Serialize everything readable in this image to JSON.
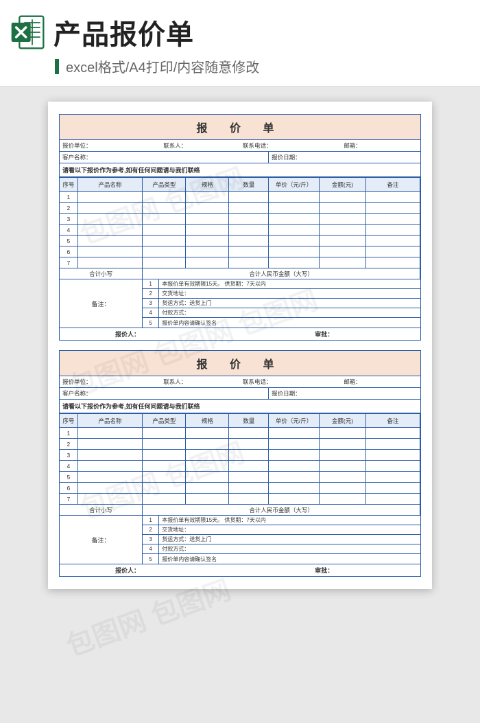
{
  "header": {
    "title": "产品报价单",
    "subtitle": "excel格式/A4打印/内容随意修改"
  },
  "sheet": {
    "title": "报 价 单",
    "info1": {
      "unit_label": "报价单位：",
      "contact_label": "联系人：",
      "phone_label": "联系电话：",
      "email_label": "邮箱："
    },
    "info2": {
      "customer_label": "客户名称：",
      "date_label": "报价日期："
    },
    "note": "请看以下报价作为参考,如有任何问题请与我们联络",
    "columns": {
      "seq": "序号",
      "name": "产品名称",
      "type": "产品类型",
      "spec": "规格",
      "qty": "数量",
      "price": "单价（元/斤）",
      "amount": "金额(元)",
      "remark": "备注"
    },
    "rows": [
      "1",
      "2",
      "3",
      "4",
      "5",
      "6",
      "7"
    ],
    "total": {
      "lower_label": "合计小写",
      "upper_label": "合计人民币金额（大写）"
    },
    "remarks": {
      "label": "备注：",
      "lines": [
        {
          "n": "1",
          "t": "本报价单有效期限15天。  供货期：7天以内"
        },
        {
          "n": "2",
          "t": "交货地址："
        },
        {
          "n": "3",
          "t": "货运方式：送货上门"
        },
        {
          "n": "4",
          "t": "付款方式："
        },
        {
          "n": "5",
          "t": "报价单内容请确认签名"
        }
      ]
    },
    "sign": {
      "quoter": "报价人：",
      "approver": "审批："
    }
  }
}
